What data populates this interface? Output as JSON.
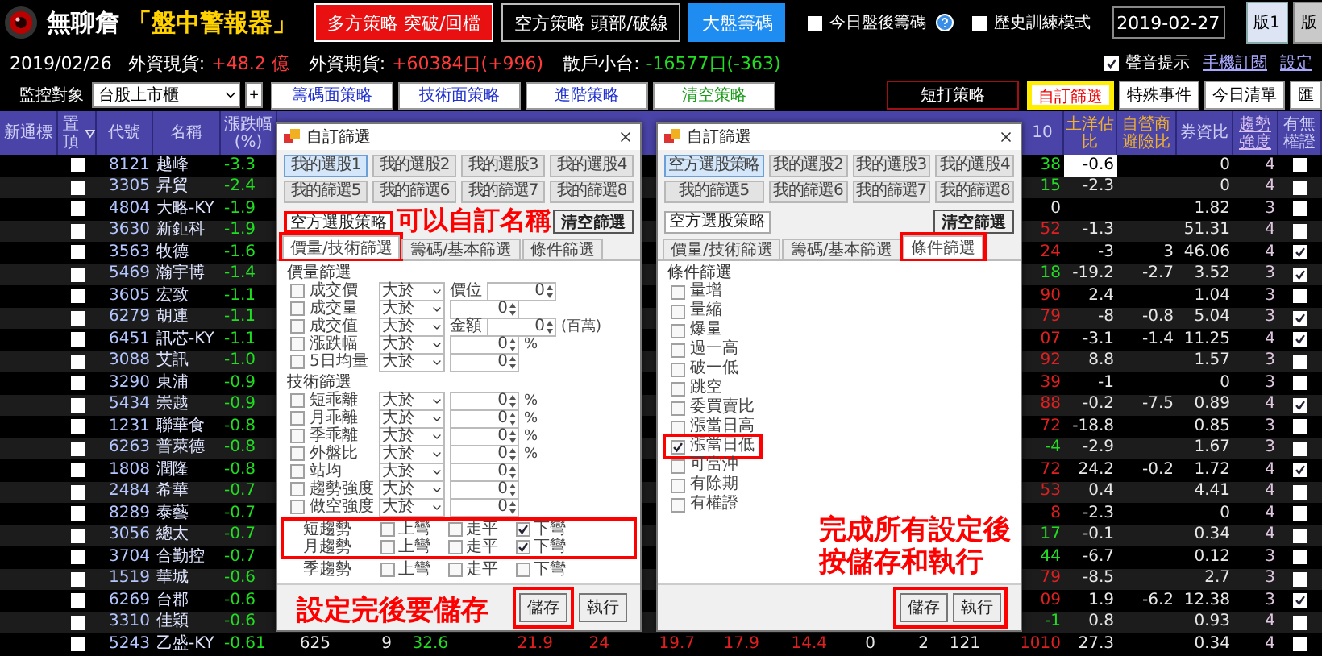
{
  "header": {
    "brand": "無聊詹",
    "subtitle": "「盤中警報器」",
    "strategy_buttons": [
      {
        "label": "多方策略 突破/回檔",
        "kind": "long"
      },
      {
        "label": "空方策略 頭部/破線",
        "kind": "short"
      },
      {
        "label": "大盤籌碼",
        "kind": "market"
      }
    ],
    "options": [
      {
        "label": "今日盤後籌碼",
        "checked": false
      },
      {
        "label": "歷史訓練模式",
        "checked": false
      }
    ],
    "date": "2019-02-27",
    "tabs": [
      {
        "label": "版1",
        "selected": true
      },
      {
        "label": "版",
        "selected": false
      }
    ]
  },
  "info_bar": {
    "date": "2019/02/26",
    "stats": [
      {
        "label": "外資現貨:",
        "value": "+48.2 億",
        "color": "#ff3b3b"
      },
      {
        "label": "外資期貨:",
        "value": "+60384口(+996)",
        "color": "#ff3b3b"
      },
      {
        "label": "散戶小台:",
        "value": "-16577口(-363)",
        "color": "#22dd22"
      }
    ],
    "sound": {
      "label": "聲音提示",
      "checked": true
    },
    "links": [
      "手機訂閱",
      "設定"
    ]
  },
  "toolbar": {
    "monitor_label": "監控對象",
    "monitor_value": "台股上市櫃",
    "add": "+",
    "strategies": [
      {
        "label": "籌碼面策略",
        "kind": "normal"
      },
      {
        "label": "技術面策略",
        "kind": "normal"
      },
      {
        "label": "進階策略",
        "kind": "normal"
      },
      {
        "label": "清空策略",
        "kind": "clear"
      }
    ],
    "views": [
      {
        "label": "短打策略",
        "kind": "group",
        "selected": false
      },
      {
        "label": "自訂篩選",
        "kind": "tab",
        "selected": true
      },
      {
        "label": "特殊事件",
        "kind": "tab",
        "selected": false
      },
      {
        "label": "今日清單",
        "kind": "tab",
        "selected": false
      },
      {
        "label": "匯",
        "kind": "tab",
        "selected": false
      }
    ]
  },
  "table": {
    "left_columns": [
      "新通標",
      "置頂",
      "代號",
      "名稱",
      "漲跌幅(%)"
    ],
    "right_columns": [
      "10",
      "土洋佔比",
      "自營商避險比",
      "券資比",
      "趨勢強度",
      "有無權證"
    ],
    "rows": [
      {
        "code": "8121",
        "name": "越峰",
        "change": "-3.3",
        "pinned": false,
        "selected": true,
        "r10": {
          "value": "38",
          "color": "#22dd22"
        },
        "tuyang": "-0.6",
        "ratio": "0",
        "trend": "4",
        "warrant": false
      },
      {
        "code": "3305",
        "name": "昇貿",
        "change": "-2.4",
        "pinned": false,
        "selected": false,
        "r10": {
          "value": "15",
          "color": "#22dd22"
        },
        "tuyang": "-2.3",
        "ratio": "0",
        "trend": "4",
        "warrant": false
      },
      {
        "code": "4804",
        "name": "大略-KY",
        "change": "-1.9",
        "pinned": false,
        "selected": false,
        "r10": {
          "value": "0",
          "color": "#e8e8e8"
        },
        "ratio": "1.82",
        "trend": "3",
        "warrant": false
      },
      {
        "code": "3630",
        "name": "新鉅科",
        "change": "-1.9",
        "pinned": false,
        "selected": false,
        "r10": {
          "value": "52",
          "color": "#e02020"
        },
        "tuyang": "-1.3",
        "ratio": "51.31",
        "trend": "4",
        "warrant": false
      },
      {
        "code": "3563",
        "name": "牧德",
        "change": "-1.6",
        "pinned": false,
        "selected": false,
        "r10": {
          "value": "24",
          "color": "#e02020"
        },
        "tuyang": "-3",
        "hedge": "3",
        "ratio": "46.06",
        "trend": "4",
        "warrant": true
      },
      {
        "code": "5469",
        "name": "瀚宇博",
        "change": "-1.4",
        "pinned": false,
        "selected": false,
        "r10": {
          "value": "18",
          "color": "#22dd22"
        },
        "tuyang": "-19.2",
        "hedge": "-2.7",
        "ratio": "3.52",
        "trend": "3",
        "warrant": true
      },
      {
        "code": "3605",
        "name": "宏致",
        "change": "-1.1",
        "pinned": false,
        "selected": false,
        "r10": {
          "value": "90",
          "color": "#e02020"
        },
        "tuyang": "2.4",
        "ratio": "1.04",
        "trend": "3",
        "warrant": false
      },
      {
        "code": "6279",
        "name": "胡連",
        "change": "-1.1",
        "pinned": false,
        "selected": false,
        "r10": {
          "value": "79",
          "color": "#e02020"
        },
        "tuyang": "-8",
        "hedge": "-0.8",
        "ratio": "5.04",
        "trend": "3",
        "warrant": true
      },
      {
        "code": "6451",
        "name": "訊芯-KY",
        "change": "-1.1",
        "pinned": false,
        "selected": false,
        "r10": {
          "value": "07",
          "color": "#e02020"
        },
        "tuyang": "-3.1",
        "hedge": "-1.4",
        "ratio": "11.25",
        "trend": "4",
        "warrant": true
      },
      {
        "code": "3088",
        "name": "艾訊",
        "change": "-1.0",
        "pinned": false,
        "selected": false,
        "r10": {
          "value": "92",
          "color": "#e02020"
        },
        "tuyang": "8.8",
        "ratio": "1.57",
        "trend": "3",
        "warrant": false
      },
      {
        "code": "3290",
        "name": "東浦",
        "change": "-0.9",
        "pinned": false,
        "selected": false,
        "r10": {
          "value": "39",
          "color": "#e02020"
        },
        "tuyang": "-1",
        "ratio": "0",
        "trend": "3",
        "warrant": false
      },
      {
        "code": "5434",
        "name": "崇越",
        "change": "-0.9",
        "pinned": false,
        "selected": false,
        "r10": {
          "value": "88",
          "color": "#e02020"
        },
        "tuyang": "-0.2",
        "hedge": "-7.5",
        "ratio": "0.89",
        "trend": "4",
        "warrant": true
      },
      {
        "code": "1231",
        "name": "聯華食",
        "change": "-0.8",
        "pinned": false,
        "selected": false,
        "r10": {
          "value": "72",
          "color": "#e02020"
        },
        "tuyang": "-18.8",
        "ratio": "0.85",
        "trend": "3",
        "warrant": false
      },
      {
        "code": "6263",
        "name": "普萊德",
        "change": "-0.8",
        "pinned": false,
        "selected": false,
        "r10": {
          "value": "-4",
          "color": "#22dd22"
        },
        "tuyang": "-2.9",
        "ratio": "1.67",
        "trend": "3",
        "warrant": false
      },
      {
        "code": "1808",
        "name": "潤隆",
        "change": "-0.8",
        "pinned": false,
        "selected": false,
        "r10": {
          "value": "72",
          "color": "#e02020"
        },
        "tuyang": "24.2",
        "hedge": "-0.2",
        "ratio": "1.72",
        "trend": "4",
        "warrant": true
      },
      {
        "code": "2484",
        "name": "希華",
        "change": "-0.7",
        "pinned": false,
        "selected": false,
        "r10": {
          "value": "53",
          "color": "#e02020"
        },
        "tuyang": "0.4",
        "ratio": "4.41",
        "trend": "4",
        "warrant": false
      },
      {
        "code": "8289",
        "name": "泰藝",
        "change": "-0.7",
        "pinned": false,
        "selected": false,
        "r10": {
          "value": "8",
          "color": "#e02020"
        },
        "tuyang": "-2.3",
        "ratio": "0",
        "trend": "4",
        "warrant": false
      },
      {
        "code": "3056",
        "name": "總太",
        "change": "-0.7",
        "pinned": false,
        "selected": false,
        "r10": {
          "value": "17",
          "color": "#22dd22"
        },
        "tuyang": "-0.1",
        "ratio": "0.34",
        "trend": "4",
        "warrant": false
      },
      {
        "code": "3704",
        "name": "合勤控",
        "change": "-0.7",
        "pinned": false,
        "selected": false,
        "r10": {
          "value": "44",
          "color": "#22dd22"
        },
        "tuyang": "-6.7",
        "ratio": "0.12",
        "trend": "3",
        "warrant": false
      },
      {
        "code": "1519",
        "name": "華城",
        "change": "-0.6",
        "pinned": false,
        "selected": false,
        "r10": {
          "value": "79",
          "color": "#e02020"
        },
        "tuyang": "-8.5",
        "ratio": "2.7",
        "trend": "3",
        "warrant": false
      },
      {
        "code": "6269",
        "name": "台郡",
        "change": "-0.6",
        "pinned": false,
        "selected": false,
        "r10": {
          "value": "09",
          "color": "#e02020"
        },
        "tuyang": "1.9",
        "hedge": "-6.2",
        "ratio": "12.38",
        "trend": "3",
        "warrant": true
      },
      {
        "code": "3310",
        "name": "佳穎",
        "change": "-0.6",
        "pinned": false,
        "selected": false,
        "r10": {
          "value": "-1",
          "color": "#22dd22"
        },
        "tuyang": "0.8",
        "ratio": "0.93",
        "trend": "4",
        "warrant": false
      },
      {
        "code": "5243",
        "name": "乙盛-KY",
        "change": "-0.61",
        "pinned": false,
        "selected": false,
        "r10": {
          "value": "1010",
          "color": "#e02020"
        },
        "tuyang": "27.3",
        "ratio": "0.34",
        "trend": "4",
        "warrant": false,
        "middle": [
          {
            "value": "625",
            "color": "#e8e8e8"
          },
          {
            "value": "9",
            "color": "#e8e8e8"
          },
          {
            "value": "32.6",
            "color": "#22dd22"
          },
          {
            "value": "21.9",
            "color": "#e02020"
          },
          {
            "value": "24",
            "color": "#e02020"
          },
          {
            "value": "19.7",
            "color": "#e02020"
          },
          {
            "value": "17.9",
            "color": "#e02020"
          },
          {
            "value": "14.4",
            "color": "#e02020"
          },
          {
            "value": "0",
            "color": "#e8e8e8"
          },
          {
            "value": "2",
            "color": "#e8e8e8"
          },
          {
            "value": "121",
            "color": "#e8e8e8"
          }
        ]
      }
    ]
  },
  "dialogs": [
    {
      "title": "自訂篩選",
      "kind": "price_tech",
      "presets": [
        {
          "label": "我的選股1",
          "selected": true
        },
        {
          "label": "我的選股2",
          "selected": false
        },
        {
          "label": "我的選股3",
          "selected": false
        },
        {
          "label": "我的選股4",
          "selected": false
        },
        {
          "label": "我的篩選5",
          "selected": false
        },
        {
          "label": "我的篩選6",
          "selected": false
        },
        {
          "label": "我的篩選7",
          "selected": false
        },
        {
          "label": "我的篩選8",
          "selected": false
        }
      ],
      "name_field": {
        "value": "空方選股策略",
        "framed": true
      },
      "clear_button": "清空篩選",
      "tabs": [
        {
          "label": "價量/技術篩選",
          "selected": true,
          "framed": true
        },
        {
          "label": "籌碼/基本篩選",
          "selected": false,
          "framed": false
        },
        {
          "label": "條件篩選",
          "selected": false,
          "framed": false
        }
      ],
      "sections": [
        {
          "heading": "價量篩選",
          "rows": [
            {
              "label": "成交價",
              "checked": false,
              "operator": "大於",
              "prefix": "價位",
              "value": "0"
            },
            {
              "label": "成交量",
              "checked": false,
              "operator": "大於",
              "value": "0"
            },
            {
              "label": "成交值",
              "checked": false,
              "operator": "大於",
              "prefix": "金額",
              "value": "0",
              "unit": "(百萬)"
            },
            {
              "label": "漲跌幅",
              "checked": false,
              "operator": "大於",
              "value": "0",
              "unit": "%"
            },
            {
              "label": "5日均量",
              "checked": false,
              "operator": "大於",
              "value": "0"
            }
          ]
        },
        {
          "heading": "技術篩選",
          "rows": [
            {
              "label": "短乖離",
              "checked": false,
              "operator": "大於",
              "value": "0",
              "unit": "%"
            },
            {
              "label": "月乖離",
              "checked": false,
              "operator": "大於",
              "value": "0",
              "unit": "%"
            },
            {
              "label": "季乖離",
              "checked": false,
              "operator": "大於",
              "value": "0",
              "unit": "%"
            },
            {
              "label": "外盤比",
              "checked": false,
              "operator": "大於",
              "value": "0",
              "unit": "%"
            },
            {
              "label": "站均",
              "checked": false,
              "operator": "大於",
              "value": "0"
            },
            {
              "label": "趨勢強度",
              "checked": false,
              "operator": "大於",
              "value": "0"
            },
            {
              "label": "做空強度",
              "checked": false,
              "operator": "大於",
              "value": "0"
            }
          ]
        }
      ],
      "trends": [
        {
          "label": "短趨勢",
          "framed": true,
          "options": [
            {
              "label": "上彎",
              "checked": false
            },
            {
              "label": "走平",
              "checked": false
            },
            {
              "label": "下彎",
              "checked": true
            }
          ]
        },
        {
          "label": "月趨勢",
          "framed": true,
          "options": [
            {
              "label": "上彎",
              "checked": false
            },
            {
              "label": "走平",
              "checked": false
            },
            {
              "label": "下彎",
              "checked": true
            }
          ]
        },
        {
          "label": "季趨勢",
          "framed": false,
          "options": [
            {
              "label": "上彎",
              "checked": false
            },
            {
              "label": "走平",
              "checked": false
            },
            {
              "label": "下彎",
              "checked": false
            }
          ]
        }
      ],
      "annotations": [
        "可以自訂名稱",
        "設定完後要儲存"
      ],
      "buttons": [
        {
          "label": "儲存",
          "framed": true
        },
        {
          "label": "執行",
          "framed": false
        }
      ]
    },
    {
      "title": "自訂篩選",
      "kind": "conditions",
      "presets": [
        {
          "label": "空方選股策略",
          "selected": true
        },
        {
          "label": "我的選股2",
          "selected": false
        },
        {
          "label": "我的選股3",
          "selected": false
        },
        {
          "label": "我的選股4",
          "selected": false
        },
        {
          "label": "我的篩選5",
          "selected": false
        },
        {
          "label": "我的篩選6",
          "selected": false
        },
        {
          "label": "我的篩選7",
          "selected": false
        },
        {
          "label": "我的篩選8",
          "selected": false
        }
      ],
      "name_field": {
        "value": "空方選股策略",
        "framed": false
      },
      "clear_button": "清空篩選",
      "tabs": [
        {
          "label": "價量/技術篩選",
          "selected": false,
          "framed": false
        },
        {
          "label": "籌碼/基本篩選",
          "selected": false,
          "framed": false
        },
        {
          "label": "條件篩選",
          "selected": true,
          "framed": true
        }
      ],
      "condition_heading": "條件篩選",
      "conditions": [
        {
          "label": "量增",
          "checked": false,
          "framed": false
        },
        {
          "label": "量縮",
          "checked": false,
          "framed": false
        },
        {
          "label": "爆量",
          "checked": false,
          "framed": false
        },
        {
          "label": "過一高",
          "checked": false,
          "framed": false
        },
        {
          "label": "破一低",
          "checked": false,
          "framed": false
        },
        {
          "label": "跳空",
          "checked": false,
          "framed": false
        },
        {
          "label": "委買賣比",
          "checked": false,
          "framed": false
        },
        {
          "label": "漲當日高",
          "checked": false,
          "framed": false
        },
        {
          "label": "漲當日低",
          "checked": true,
          "framed": true
        },
        {
          "label": "可當沖",
          "checked": false,
          "framed": false
        },
        {
          "label": "有除期",
          "checked": false,
          "framed": false
        },
        {
          "label": "有權證",
          "checked": false,
          "framed": false
        }
      ],
      "annotations": [
        "完成所有設定後按儲存和執行"
      ],
      "buttons": [
        {
          "label": "儲存",
          "framed": true
        },
        {
          "label": "執行",
          "framed": true
        }
      ]
    }
  ]
}
